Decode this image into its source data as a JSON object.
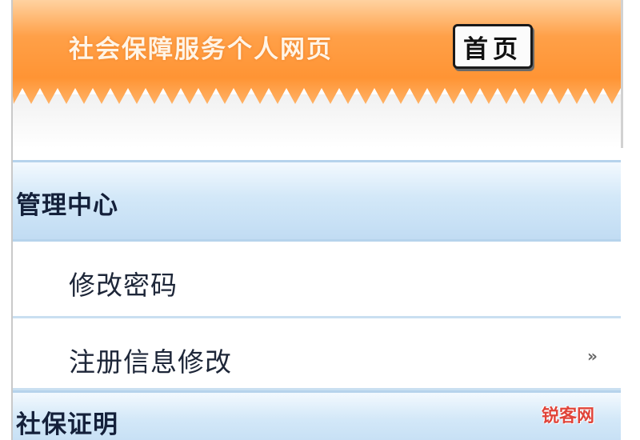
{
  "header": {
    "title": "社会保障服务个人网页",
    "home_label": "首页",
    "colors": {
      "top": "#ff9a3c",
      "bottom": "#ffd7a6"
    }
  },
  "menu": {
    "sections": [
      {
        "label": "管理中心",
        "items": [
          {
            "label": "修改密码",
            "has_arrow": false
          },
          {
            "label": "注册信息修改",
            "has_arrow": true,
            "arrow": "»"
          }
        ]
      },
      {
        "label": "社保证明",
        "items": []
      }
    ],
    "colors": {
      "section_bg": "#d3e8f8",
      "divider": "#b6d3ec"
    }
  },
  "watermark": {
    "text": "锐客网"
  }
}
